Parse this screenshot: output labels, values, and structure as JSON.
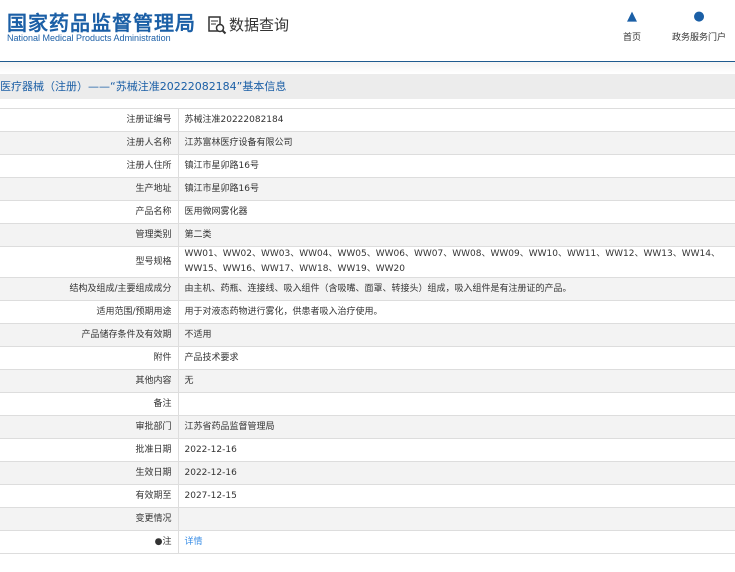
{
  "header": {
    "logo_cn": "国家药品监督管理局",
    "logo_en": "National Medical Products Administration",
    "query_label": "数据查询",
    "nav": [
      {
        "label": "首页",
        "icon": "home-icon"
      },
      {
        "label": "政务服务门户",
        "icon": "user-icon"
      }
    ]
  },
  "title": "医疗器械（注册）——“苏械注准20222082184”基本信息",
  "rows": [
    {
      "label": "注册证编号",
      "value": "苏械注准20222082184"
    },
    {
      "label": "注册人名称",
      "value": "江苏富林医疗设备有限公司"
    },
    {
      "label": "注册人住所",
      "value": "镇江市星卯路16号"
    },
    {
      "label": "生产地址",
      "value": "镇江市星卯路16号"
    },
    {
      "label": "产品名称",
      "value": "医用微网雾化器"
    },
    {
      "label": "管理类别",
      "value": "第二类"
    },
    {
      "label": "型号规格",
      "value": "WW01、WW02、WW03、WW04、WW05、WW06、WW07、WW08、WW09、WW10、WW11、WW12、WW13、WW14、WW15、WW16、WW17、WW18、WW19、WW20"
    },
    {
      "label": "结构及组成/主要组成成分",
      "value": "由主机、药瓶、连接线、吸入组件（含吸嘴、面罩、转接头）组成，吸入组件是有注册证的产品。"
    },
    {
      "label": "适用范围/预期用途",
      "value": "用于对液态药物进行雾化，供患者吸入治疗使用。"
    },
    {
      "label": "产品储存条件及有效期",
      "value": "不适用"
    },
    {
      "label": "附件",
      "value": "产品技术要求"
    },
    {
      "label": "其他内容",
      "value": "无"
    },
    {
      "label": "备注",
      "value": ""
    },
    {
      "label": "审批部门",
      "value": "江苏省药品监督管理局"
    },
    {
      "label": "批准日期",
      "value": "2022-12-16"
    },
    {
      "label": "生效日期",
      "value": "2022-12-16"
    },
    {
      "label": "有效期至",
      "value": "2027-12-15"
    },
    {
      "label": "变更情况",
      "value": ""
    }
  ],
  "note": {
    "label": "注",
    "link": "详情"
  }
}
